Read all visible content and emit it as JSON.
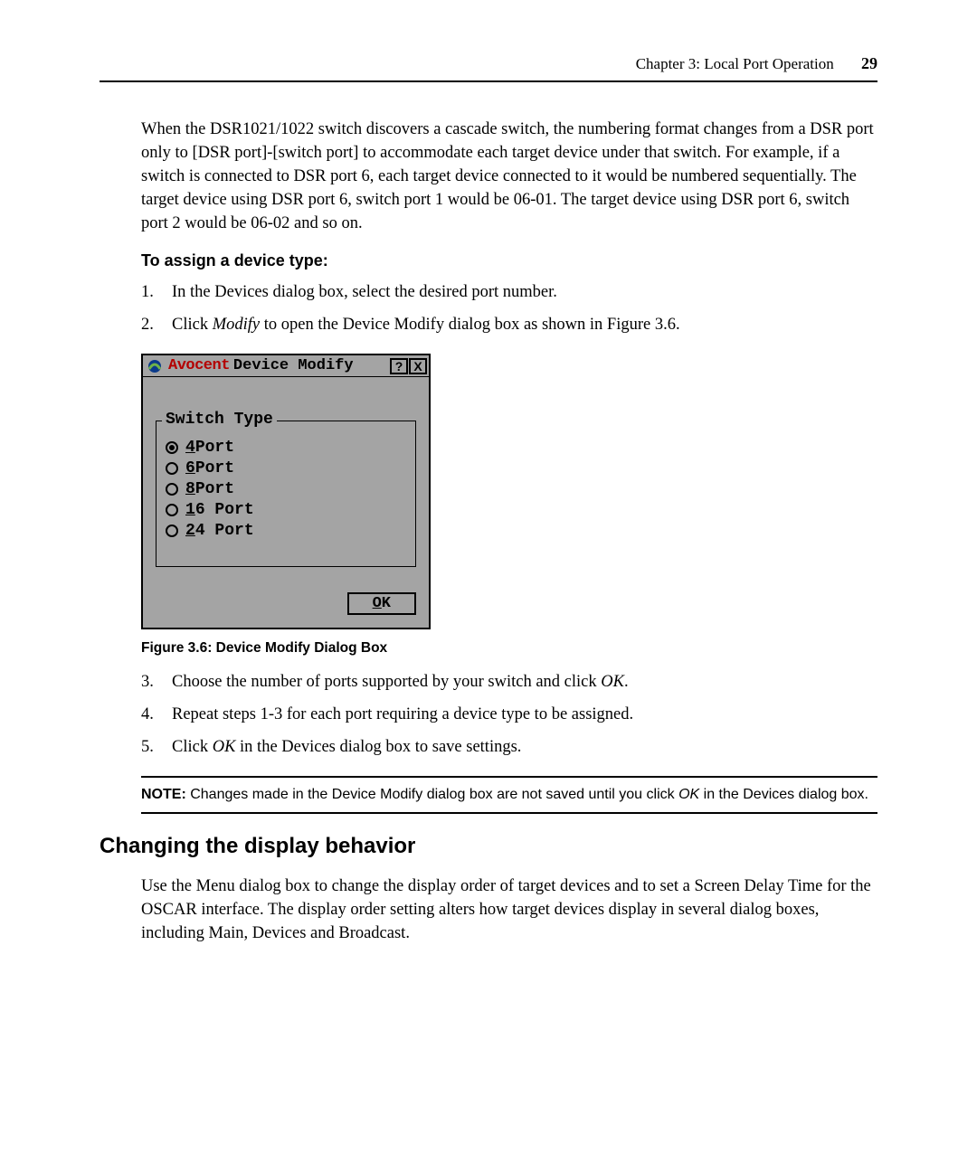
{
  "header": {
    "chapter": "Chapter 3: Local Port Operation",
    "page": "29"
  },
  "intro": "When the DSR1021/1022 switch discovers a cascade switch, the numbering format changes from a DSR port only to [DSR port]-[switch port] to accommodate each target device under that switch. For example, if a switch is connected to DSR port 6, each target device connected to it would be numbered sequentially. The target device using DSR port 6, switch port 1 would be 06-01. The target device using DSR port 6, switch port 2 would be 06-02 and so on.",
  "assign_heading": "To assign a device type:",
  "steps_a": [
    {
      "n": "1.",
      "t_pre": "In the Devices dialog box, select the desired port number.",
      "ital": "",
      "t_post": ""
    },
    {
      "n": "2.",
      "t_pre": "Click ",
      "ital": "Modify",
      "t_post": " to open the Device Modify dialog box as shown in Figure 3.6."
    }
  ],
  "dialog": {
    "brand": "Avocent",
    "title": "Device Modify",
    "help": "?",
    "close": "X",
    "legend": "Switch Type",
    "options": [
      {
        "accel": "4",
        "rest": " Port",
        "selected": true
      },
      {
        "accel": "6",
        "rest": " Port",
        "selected": false
      },
      {
        "accel": "8",
        "rest": " Port",
        "selected": false
      },
      {
        "accel": "1",
        "rest": "6 Port",
        "selected": false
      },
      {
        "accel": "2",
        "rest": "4 Port",
        "selected": false
      }
    ],
    "ok_accel": "O",
    "ok_rest": "K"
  },
  "figcaption": "Figure 3.6: Device Modify Dialog Box",
  "steps_b": [
    {
      "n": "3.",
      "t_pre": "Choose the number of ports supported by your switch and click ",
      "ital": "OK",
      "t_post": "."
    },
    {
      "n": "4.",
      "t_pre": "Repeat steps 1-3 for each port requiring a device type to be assigned.",
      "ital": "",
      "t_post": ""
    },
    {
      "n": "5.",
      "t_pre": "Click ",
      "ital": "OK",
      "t_post": " in the Devices dialog box to save settings."
    }
  ],
  "note": {
    "label": "NOTE:",
    "pre": "  Changes made in the Device Modify dialog box are not saved until you click ",
    "ok": "OK",
    "post": " in the Devices dialog box."
  },
  "section_heading": "Changing the display behavior",
  "section_body": "Use the Menu dialog box to change the display order of target devices and to set a Screen Delay Time for the OSCAR interface. The display order setting alters how target devices display in several dialog boxes, including Main, Devices and Broadcast."
}
